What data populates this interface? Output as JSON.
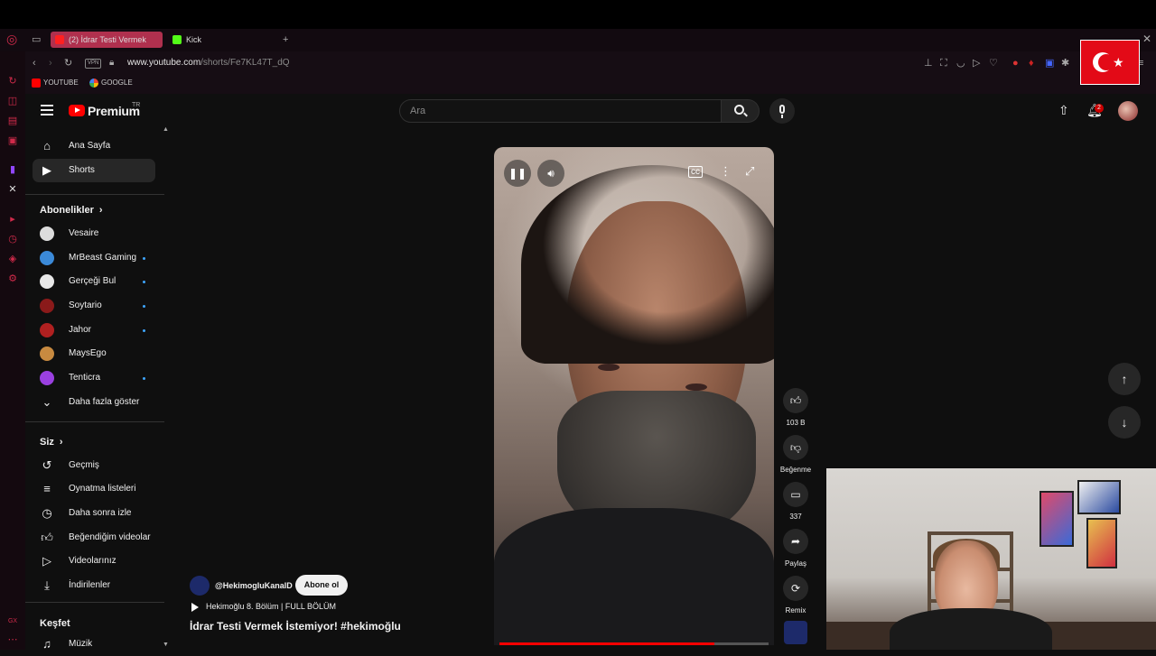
{
  "browser": {
    "tabs": [
      {
        "label": "(2) İdrar Testi Vermek",
        "active": true
      },
      {
        "label": "Kick",
        "active": false
      }
    ],
    "new_tab": "+",
    "vpn_badge": "VPN",
    "url_host": "www.youtube.com",
    "url_path": "/shorts/Fe7KL47T_dQ",
    "bookmarks": [
      {
        "label": "YOUTUBE"
      },
      {
        "label": "GOOGLE"
      }
    ],
    "sidebar_bottom_label": "GX"
  },
  "header": {
    "logo_text": "Premium",
    "region": "TR",
    "search_placeholder": "Ara",
    "notification_count": "2"
  },
  "sidebar": {
    "main": [
      {
        "label": "Ana Sayfa",
        "icon": "home-icon",
        "selected": false
      },
      {
        "label": "Shorts",
        "icon": "shorts-icon",
        "selected": true
      }
    ],
    "subs_heading": "Abonelikler",
    "subscriptions": [
      {
        "label": "Vesaire",
        "color": "#dcdcdc",
        "new": false
      },
      {
        "label": "MrBeast Gaming",
        "color": "#3b8ad8",
        "new": true
      },
      {
        "label": "Gerçeği Bul",
        "color": "#e8e8e8",
        "new": true
      },
      {
        "label": "Soytario",
        "color": "#8a1a1a",
        "new": true
      },
      {
        "label": "Jahor",
        "color": "#b02020",
        "new": true
      },
      {
        "label": "MaysEgo",
        "color": "#c88a40",
        "new": false
      },
      {
        "label": "Tenticra",
        "color": "#9a40e0",
        "new": true
      }
    ],
    "show_more": "Daha fazla göster",
    "you_heading": "Siz",
    "you_items": [
      {
        "label": "Geçmiş",
        "icon": "history-icon"
      },
      {
        "label": "Oynatma listeleri",
        "icon": "playlist-icon"
      },
      {
        "label": "Daha sonra izle",
        "icon": "clock-icon"
      },
      {
        "label": "Beğendiğim videolar",
        "icon": "like-icon"
      },
      {
        "label": "Videolarınız",
        "icon": "video-icon"
      },
      {
        "label": "İndirilenler",
        "icon": "download-icon"
      }
    ],
    "explore_heading": "Keşfet",
    "explore_items": [
      {
        "label": "Müzik",
        "icon": "music-icon"
      }
    ]
  },
  "short": {
    "channel": "@HekimogluKanalD",
    "subscribe": "Abone ol",
    "playlist": "Hekimoğlu 8. Bölüm | FULL BÖLÜM",
    "title": "İdrar Testi Vermek İstemiyor! #hekimoğlu",
    "progress": 0.8,
    "actions": {
      "likes": "103 B",
      "dislike": "Beğenme",
      "comments": "337",
      "share": "Paylaş",
      "remix": "Remix"
    }
  },
  "colors": {
    "accent": "#ff0000",
    "browser_accent": "#d02a4a",
    "new_dot": "#3ea6ff"
  }
}
